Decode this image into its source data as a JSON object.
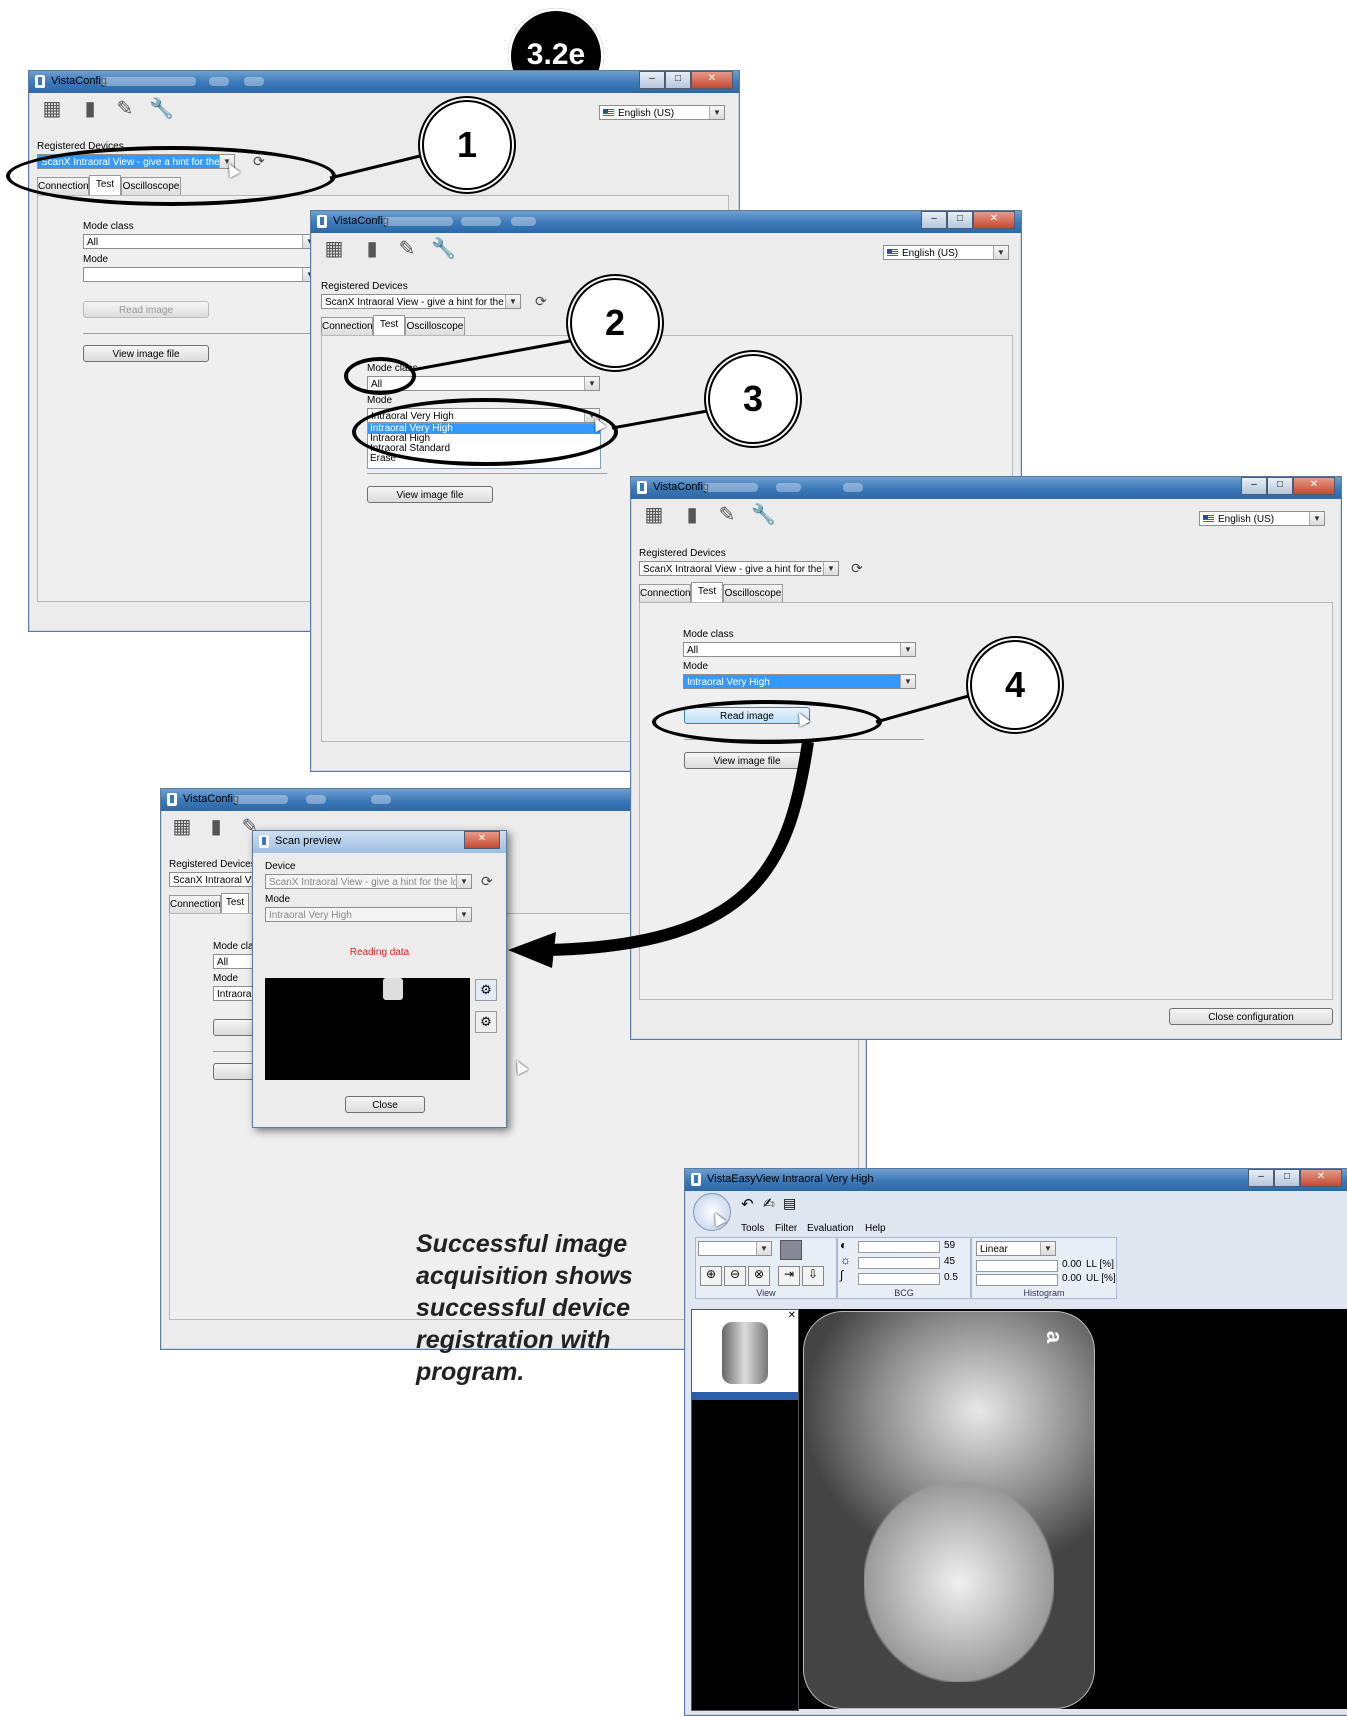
{
  "badge": "3.2e",
  "callouts": [
    "1",
    "2",
    "3",
    "4"
  ],
  "caption": "Successful image acquisition shows successful device registration with program.",
  "vistaconfig": {
    "title": "VistaConfig",
    "language": "English (US)",
    "registered_devices_label": "Registered Devices",
    "device_value": "ScanX Intraoral View - give a hint for the locatio",
    "tabs": [
      "Connection",
      "Test",
      "Oscilloscope"
    ],
    "mode_class_label": "Mode class",
    "mode_class_value": "All",
    "mode_label": "Mode",
    "mode_value_empty": "",
    "mode_value": "Intraoral Very High",
    "read_image": "Read image",
    "view_image_file": "View image file",
    "close_configuration": "Close configuration",
    "mode_options": [
      "Intraoral Very High",
      "Intraoral High",
      "Intraoral Standard",
      "Erase"
    ]
  },
  "window4": {
    "device_value": "ScanX Intraoral View",
    "mode_class_label": "Mode clas",
    "mode_value": "Intraoral V"
  },
  "scan_preview": {
    "title": "Scan preview",
    "device_label": "Device",
    "device_value": "ScanX Intraoral View - give a hint for the loc",
    "mode_label": "Mode",
    "mode_value": "Intraoral Very High",
    "status": "Reading data",
    "close": "Close",
    "status_color": "#e02020"
  },
  "vistaeasyview": {
    "title": "VistaEasyView  Intraoral Very High",
    "menu": [
      "Tools",
      "Filter",
      "Evaluation",
      "Help"
    ],
    "bcg": {
      "contrast": "59",
      "brightness": "45",
      "gamma": "0.5",
      "label": "BCG"
    },
    "histogram": {
      "mode": "Linear",
      "ll_value": "0.00",
      "ll_label": "LL [%]",
      "ul_value": "0.00",
      "ul_label": "UL [%]",
      "label": "Histogram"
    },
    "view_label": "View",
    "image_letter": "a"
  }
}
